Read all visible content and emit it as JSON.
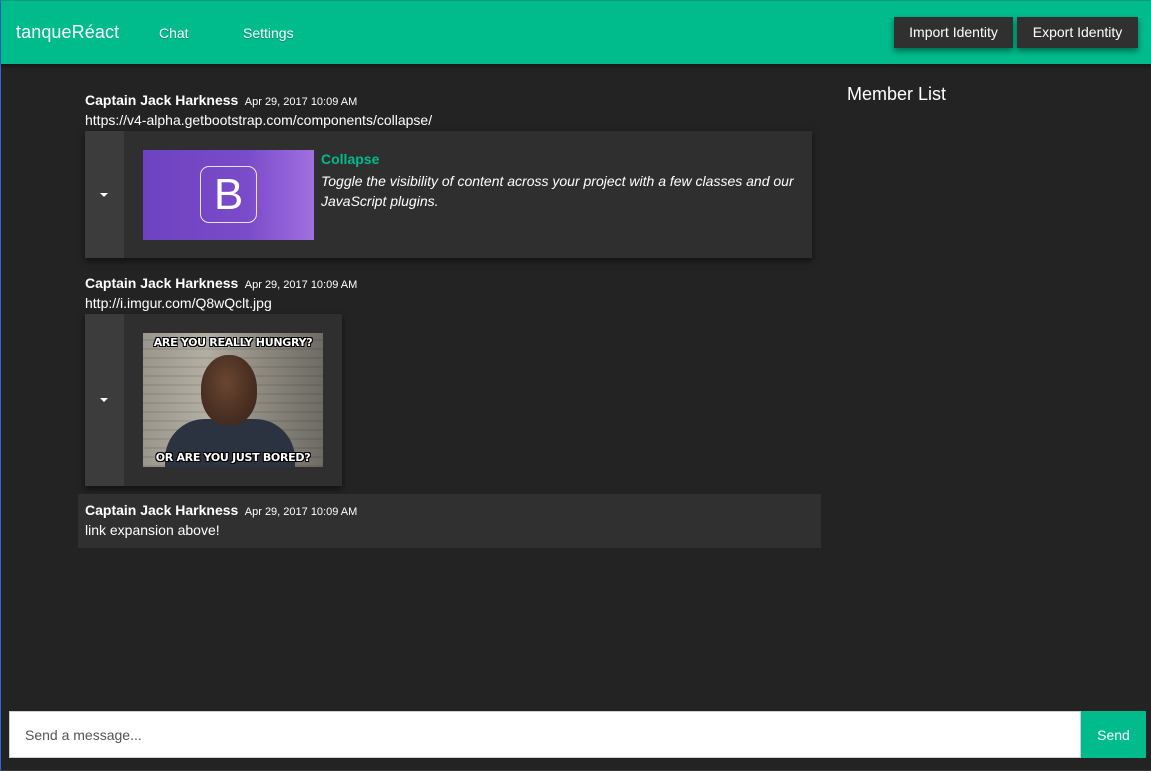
{
  "header": {
    "brand": "tanqueRéact",
    "nav": {
      "chat": "Chat",
      "settings": "Settings"
    },
    "import_label": "Import Identity",
    "export_label": "Export Identity",
    "accent_color": "#00bc8c"
  },
  "messages": [
    {
      "author": "Captain Jack Harkness",
      "time": "Apr 29, 2017 10:09 AM",
      "text": "https://v4-alpha.getbootstrap.com/components/collapse/",
      "embed": {
        "thumbnail_text": "B",
        "title": "Collapse",
        "description": "Toggle the visibility of content across your project with a few classes and our JavaScript plugins.",
        "toggle_icon": "caret-down-icon"
      }
    },
    {
      "author": "Captain Jack Harkness",
      "time": "Apr 29, 2017 10:09 AM",
      "text": "http://i.imgur.com/Q8wQclt.jpg",
      "embed": {
        "image_caption_top": "ARE YOU REALLY HUNGRY?",
        "image_caption_bottom": "OR ARE YOU JUST BORED?",
        "toggle_icon": "caret-down-icon"
      }
    },
    {
      "author": "Captain Jack Harkness",
      "time": "Apr 29, 2017 10:09 AM",
      "text": "link expansion above!"
    }
  ],
  "member_list": {
    "title": "Member List"
  },
  "composer": {
    "placeholder": "Send a message...",
    "send_label": "Send"
  }
}
